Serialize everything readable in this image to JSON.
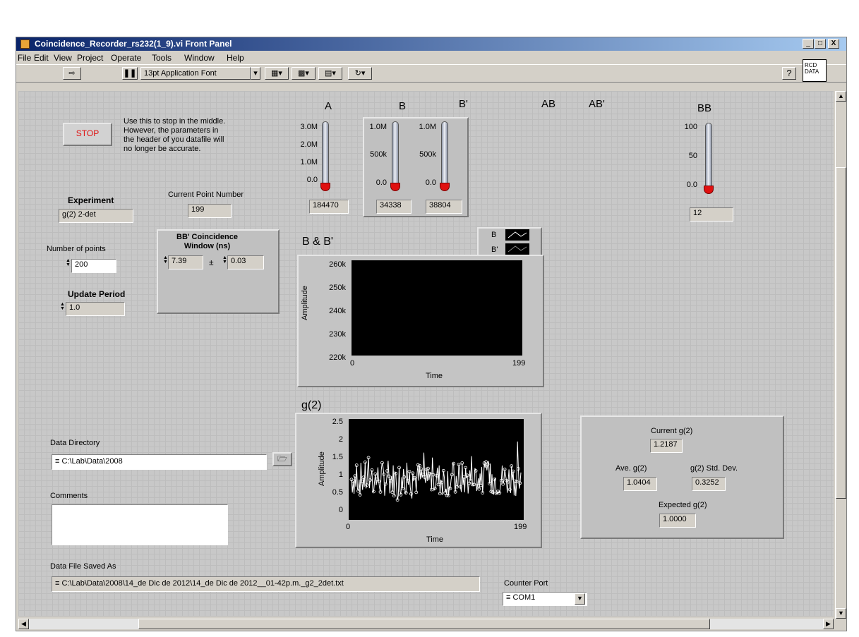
{
  "window": {
    "title": "Coincidence_Recorder_rs232(1_9).vi Front Panel",
    "min": "_",
    "max": "□",
    "close": "X"
  },
  "menu": [
    "File",
    "Edit",
    "View",
    "Project",
    "Operate",
    "Tools",
    "Window",
    "Help"
  ],
  "toolbar": {
    "font": "13pt Application Font",
    "vi_icon_line1": "RCD",
    "vi_icon_line2": "DATA",
    "help": "?"
  },
  "stop": {
    "label": "STOP",
    "note_lines": [
      "Use this to stop in the middle.",
      "However, the parameters in",
      "the header of you datafile will",
      "no longer be accurate."
    ]
  },
  "experiment": {
    "label": "Experiment",
    "value": "g(2) 2-det"
  },
  "current_point": {
    "label": "Current Point Number",
    "value": "199"
  },
  "num_points": {
    "label": "Number of points",
    "value": "200"
  },
  "update_period": {
    "label": "Update Period",
    "value": "1.0"
  },
  "window_ns": {
    "label_line1": "BB' Coincidence",
    "label_line2": "Window (ns)",
    "value": "7.39",
    "pm": "±",
    "tol": "0.03"
  },
  "meters": {
    "A": {
      "label": "A",
      "ticks": [
        "3.0M",
        "2.0M",
        "1.0M",
        "0.0"
      ],
      "value": "184470"
    },
    "B": {
      "label": "B",
      "ticks": [
        "1.0M",
        "500k",
        "0.0"
      ],
      "value": "34338"
    },
    "Bp": {
      "label": "B'",
      "ticks": [
        "1.0M",
        "500k",
        "0.0"
      ],
      "value": "38804"
    },
    "AB": {
      "label": "AB"
    },
    "ABp": {
      "label": "AB'"
    },
    "BB": {
      "label": "BB",
      "ticks": [
        "100",
        "50",
        "0.0"
      ],
      "value": "12"
    }
  },
  "bb_chart": {
    "title": "B & B'",
    "legend": [
      "B",
      "B'"
    ],
    "yticks": [
      "260k",
      "250k",
      "240k",
      "230k",
      "220k"
    ],
    "ylabel": "Amplitude",
    "xticks": [
      "0",
      "199"
    ],
    "xlabel": "Time"
  },
  "g2_chart": {
    "title": "g(2)",
    "yticks": [
      "2.5",
      "2",
      "1.5",
      "1",
      "0.5",
      "0"
    ],
    "ylabel": "Amplitude",
    "xticks": [
      "0",
      "199"
    ],
    "xlabel": "Time"
  },
  "stats": {
    "current_label": "Current g(2)",
    "current_value": "1.2187",
    "ave_label": "Ave. g(2)",
    "ave_value": "1.0404",
    "std_label": "g(2) Std. Dev.",
    "std_value": "0.3252",
    "expected_label": "Expected g(2)",
    "expected_value": "1.0000"
  },
  "data_directory": {
    "label": "Data Directory",
    "value": "C:\\Lab\\Data\\2008"
  },
  "comments": {
    "label": "Comments",
    "value": ""
  },
  "saved_as": {
    "label": "Data File Saved As",
    "value": "C:\\Lab\\Data\\2008\\14_de Dic de 2012\\14_de Dic de 2012__01-42p.m._g2_2det.txt"
  },
  "counter_port": {
    "label": "Counter Port",
    "value": "COM1"
  },
  "colors": {
    "title_start": "#0a246a",
    "title_end": "#a6caf0",
    "stop_text": "#e01010",
    "plot_bg": "#000000"
  },
  "chart_data": {
    "type": "line",
    "title": "g(2)",
    "ylabel": "Amplitude",
    "xlabel": "Time",
    "ylim": [
      0,
      2.5
    ],
    "xlim": [
      0,
      199
    ]
  }
}
